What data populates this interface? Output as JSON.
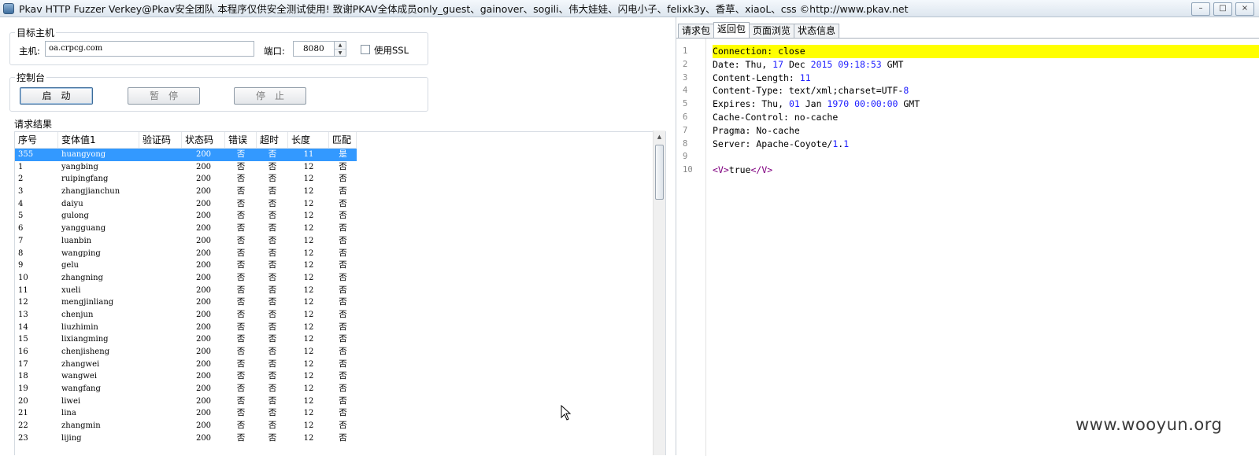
{
  "window": {
    "title": "Pkav HTTP Fuzzer   Verkey@Pkav安全团队  本程序仅供安全测试使用!  致谢PKAV全体成员only_guest、gainover、sogili、伟大娃娃、闪电小子、felixk3y、香草、xiaoL、css  ©http://www.pkav.net",
    "controls": [
      "–",
      "□",
      "×"
    ]
  },
  "target": {
    "group_title": "目标主机",
    "host_label": "主机:",
    "host_value": "oa.crpcg.com",
    "port_label": "端口:",
    "port_value": "8080",
    "ssl_label": "使用SSL",
    "ssl_checked": false
  },
  "console": {
    "group_title": "控制台",
    "start": "启动",
    "pause": "暂停",
    "stop": "停止"
  },
  "results": {
    "group_title": "请求结果",
    "columns": [
      "序号",
      "变体值1",
      "验证码",
      "状态码",
      "错误",
      "超时",
      "长度",
      "匹配"
    ],
    "rows": [
      {
        "num": "355",
        "var": "huangyong",
        "code": "",
        "status": "200",
        "err": "否",
        "timeout": "否",
        "len": "11",
        "match": "是",
        "selected": true
      },
      {
        "num": "1",
        "var": "yangbing",
        "code": "",
        "status": "200",
        "err": "否",
        "timeout": "否",
        "len": "12",
        "match": "否"
      },
      {
        "num": "2",
        "var": "ruipingfang",
        "code": "",
        "status": "200",
        "err": "否",
        "timeout": "否",
        "len": "12",
        "match": "否"
      },
      {
        "num": "3",
        "var": "zhangjianchun",
        "code": "",
        "status": "200",
        "err": "否",
        "timeout": "否",
        "len": "12",
        "match": "否"
      },
      {
        "num": "4",
        "var": "daiyu",
        "code": "",
        "status": "200",
        "err": "否",
        "timeout": "否",
        "len": "12",
        "match": "否"
      },
      {
        "num": "5",
        "var": "gulong",
        "code": "",
        "status": "200",
        "err": "否",
        "timeout": "否",
        "len": "12",
        "match": "否"
      },
      {
        "num": "6",
        "var": "yangguang",
        "code": "",
        "status": "200",
        "err": "否",
        "timeout": "否",
        "len": "12",
        "match": "否"
      },
      {
        "num": "7",
        "var": "luanbin",
        "code": "",
        "status": "200",
        "err": "否",
        "timeout": "否",
        "len": "12",
        "match": "否"
      },
      {
        "num": "8",
        "var": "wangping",
        "code": "",
        "status": "200",
        "err": "否",
        "timeout": "否",
        "len": "12",
        "match": "否"
      },
      {
        "num": "9",
        "var": "gelu",
        "code": "",
        "status": "200",
        "err": "否",
        "timeout": "否",
        "len": "12",
        "match": "否"
      },
      {
        "num": "10",
        "var": "zhangning",
        "code": "",
        "status": "200",
        "err": "否",
        "timeout": "否",
        "len": "12",
        "match": "否"
      },
      {
        "num": "11",
        "var": "xueli",
        "code": "",
        "status": "200",
        "err": "否",
        "timeout": "否",
        "len": "12",
        "match": "否"
      },
      {
        "num": "12",
        "var": "mengjinliang",
        "code": "",
        "status": "200",
        "err": "否",
        "timeout": "否",
        "len": "12",
        "match": "否"
      },
      {
        "num": "13",
        "var": "chenjun",
        "code": "",
        "status": "200",
        "err": "否",
        "timeout": "否",
        "len": "12",
        "match": "否"
      },
      {
        "num": "14",
        "var": "liuzhimin",
        "code": "",
        "status": "200",
        "err": "否",
        "timeout": "否",
        "len": "12",
        "match": "否"
      },
      {
        "num": "15",
        "var": "lixiangming",
        "code": "",
        "status": "200",
        "err": "否",
        "timeout": "否",
        "len": "12",
        "match": "否"
      },
      {
        "num": "16",
        "var": "chenjisheng",
        "code": "",
        "status": "200",
        "err": "否",
        "timeout": "否",
        "len": "12",
        "match": "否"
      },
      {
        "num": "17",
        "var": "zhangwei",
        "code": "",
        "status": "200",
        "err": "否",
        "timeout": "否",
        "len": "12",
        "match": "否"
      },
      {
        "num": "18",
        "var": "wangwei",
        "code": "",
        "status": "200",
        "err": "否",
        "timeout": "否",
        "len": "12",
        "match": "否"
      },
      {
        "num": "19",
        "var": "wangfang",
        "code": "",
        "status": "200",
        "err": "否",
        "timeout": "否",
        "len": "12",
        "match": "否"
      },
      {
        "num": "20",
        "var": "liwei",
        "code": "",
        "status": "200",
        "err": "否",
        "timeout": "否",
        "len": "12",
        "match": "否"
      },
      {
        "num": "21",
        "var": "lina",
        "code": "",
        "status": "200",
        "err": "否",
        "timeout": "否",
        "len": "12",
        "match": "否"
      },
      {
        "num": "22",
        "var": "zhangmin",
        "code": "",
        "status": "200",
        "err": "否",
        "timeout": "否",
        "len": "12",
        "match": "否"
      },
      {
        "num": "23",
        "var": "lijing",
        "code": "",
        "status": "200",
        "err": "否",
        "timeout": "否",
        "len": "12",
        "match": "否"
      }
    ]
  },
  "response": {
    "tabs": [
      {
        "label": "请求包",
        "active": false
      },
      {
        "label": "返回包",
        "active": true
      },
      {
        "label": "页面浏览",
        "active": false
      },
      {
        "label": "状态信息",
        "active": false
      }
    ],
    "lines": [
      {
        "n": "1",
        "text": "Connection: close",
        "highlight": true
      },
      {
        "n": "2",
        "text": "Date: Thu, 17 Dec 2015 09:18:53 GMT"
      },
      {
        "n": "3",
        "text": "Content-Length: 11"
      },
      {
        "n": "4",
        "text": "Content-Type: text/xml;charset=UTF-8"
      },
      {
        "n": "5",
        "text": "Expires: Thu, 01 Jan 1970 00:00:00 GMT"
      },
      {
        "n": "6",
        "text": "Cache-Control: no-cache"
      },
      {
        "n": "7",
        "text": "Pragma: No-cache"
      },
      {
        "n": "8",
        "text": "Server: Apache-Coyote/1.1"
      },
      {
        "n": "9",
        "text": ""
      },
      {
        "n": "10",
        "text": "<V>true</V>"
      }
    ]
  },
  "watermark": "www.wooyun.org",
  "colors": {
    "selection": "#3399ff",
    "highlight_line": "#ffff00",
    "number_token": "#1f1fff",
    "tag_token": "#800080"
  }
}
